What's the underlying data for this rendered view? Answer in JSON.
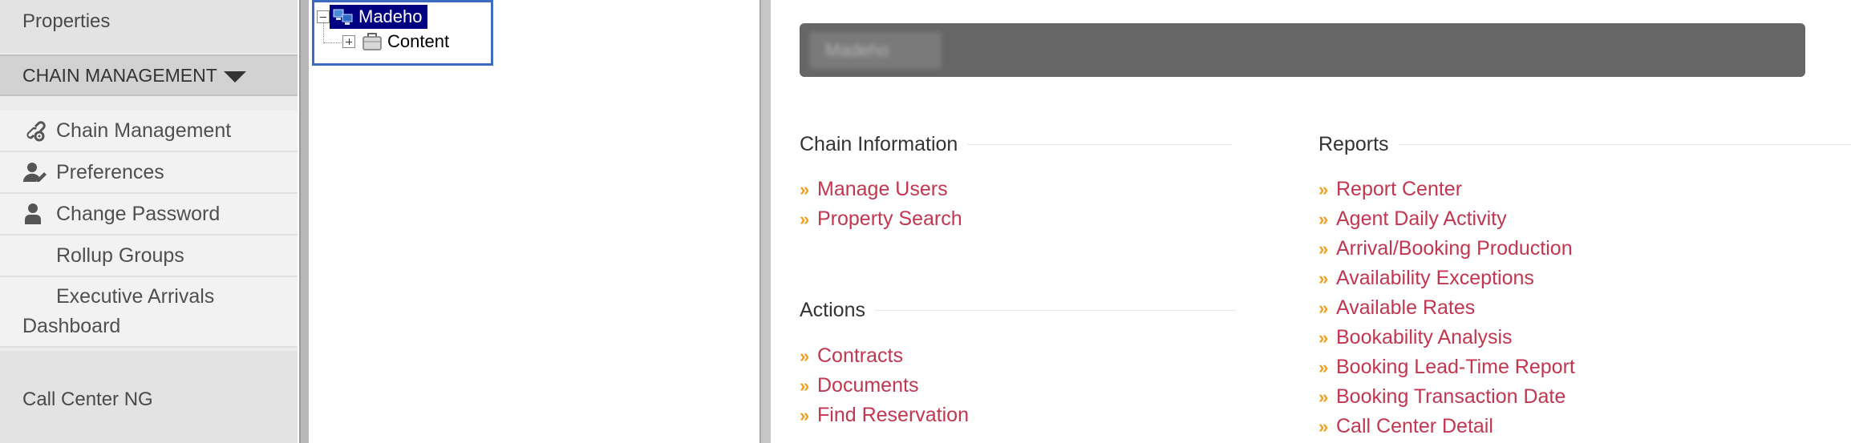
{
  "sidebar": {
    "properties_label": "Properties",
    "chain_header": "CHAIN MANAGEMENT",
    "items": [
      {
        "label": "Chain Management",
        "icon": "link-gear-icon"
      },
      {
        "label": "Preferences",
        "icon": "user-edit-icon"
      },
      {
        "label": "Change Password",
        "icon": "user-lock-icon"
      },
      {
        "label": "Rollup Groups",
        "icon": ""
      },
      {
        "label_line1": "Executive Arrivals",
        "label_line2": "Dashboard",
        "icon": ""
      }
    ],
    "call_center_label": "Call Center NG"
  },
  "tree": {
    "root_label": "Madeho",
    "child_label": "Content"
  },
  "main": {
    "banner_name": "Madeho",
    "chain_info": {
      "title": "Chain Information",
      "links": [
        "Manage Users",
        "Property Search"
      ]
    },
    "actions": {
      "title": "Actions",
      "links": [
        "Contracts",
        "Documents",
        "Find Reservation"
      ]
    },
    "reports": {
      "title": "Reports",
      "links": [
        "Report Center",
        "Agent Daily Activity",
        "Arrival/Booking Production",
        "Availability Exceptions",
        "Available Rates",
        "Bookability Analysis",
        "Booking Lead-Time Report",
        "Booking Transaction Date",
        "Call Center Detail"
      ]
    },
    "bullet": "»"
  },
  "colors": {
    "link": "#c2364f",
    "bullet": "#f0a020",
    "banner": "#666666",
    "tree_selected": "#000080",
    "focus_border": "#3d6bbf"
  }
}
